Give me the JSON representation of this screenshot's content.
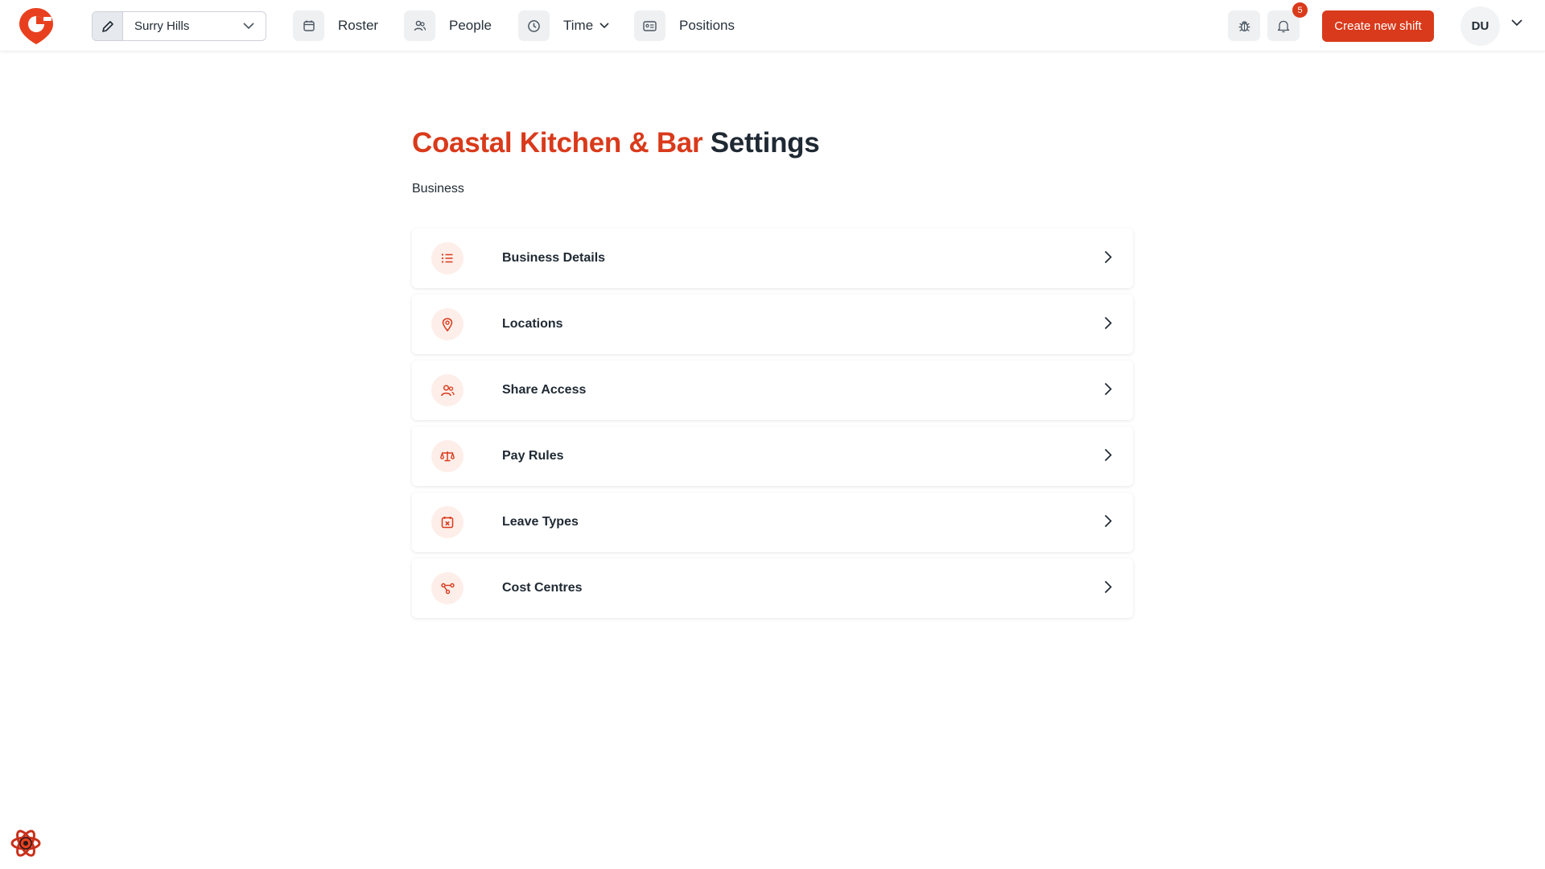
{
  "header": {
    "location_select": {
      "value": "Surry Hills",
      "edit_icon": "pencil-icon",
      "dropdown_icon": "chevron-down-icon"
    },
    "nav": [
      {
        "label": "Roster",
        "icon": "calendar-icon"
      },
      {
        "label": "People",
        "icon": "users-icon"
      },
      {
        "label": "Time",
        "icon": "clock-icon",
        "has_dropdown": true
      },
      {
        "label": "Positions",
        "icon": "id-card-icon"
      }
    ],
    "bug_icon": "bug-icon",
    "notifications": {
      "icon": "bell-icon",
      "count": "5"
    },
    "create_button": "Create new shift",
    "avatar": "DU"
  },
  "page": {
    "title_business": "Coastal Kitchen & Bar",
    "title_suffix": "Settings",
    "section": "Business"
  },
  "settings_items": [
    {
      "label": "Business Details",
      "icon": "list-icon"
    },
    {
      "label": "Locations",
      "icon": "map-pin-icon"
    },
    {
      "label": "Share Access",
      "icon": "users-icon"
    },
    {
      "label": "Pay Rules",
      "icon": "scales-icon"
    },
    {
      "label": "Leave Types",
      "icon": "calendar-x-icon"
    },
    {
      "label": "Cost Centres",
      "icon": "network-icon"
    }
  ],
  "colors": {
    "accent": "#d93a1b",
    "accent_soft": "#fdeee9",
    "text": "#1f2933"
  }
}
